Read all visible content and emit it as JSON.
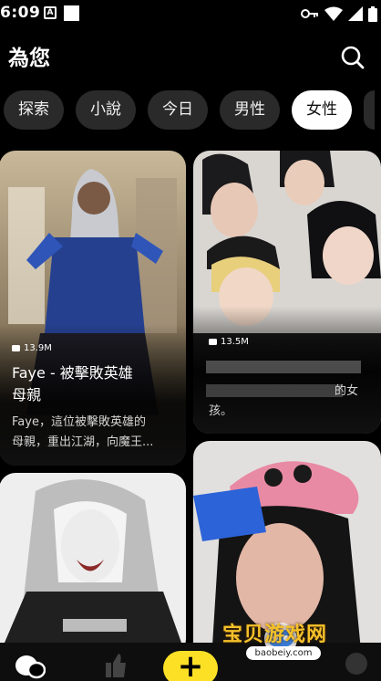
{
  "status_bar": {
    "time": "6:09",
    "notification_letter": "A"
  },
  "header": {
    "title": "為您"
  },
  "chips": [
    {
      "label": "探索",
      "active": false
    },
    {
      "label": "小說",
      "active": false
    },
    {
      "label": "今日",
      "active": false
    },
    {
      "label": "男性",
      "active": false
    },
    {
      "label": "女性",
      "active": true
    }
  ],
  "cards": [
    {
      "views": "13.9M",
      "title_line1": "Faye - 被擊敗英雄",
      "title_line2": "母親",
      "desc_line1": "Faye，這位被擊敗英雄的",
      "desc_line2": "母親，重出江湖，向魔王..."
    },
    {
      "views": "13.5M",
      "title_line1": "",
      "desc_line1": "的女",
      "desc_line2": "孩。"
    }
  ],
  "watermark": {
    "text": "宝贝游戏网",
    "url": "baobeiy.com"
  },
  "nav": {
    "create_label": "+"
  },
  "colors": {
    "accent": "#fbe026",
    "chip_bg": "#2a2a2a",
    "card_bg": "#1a1a1a"
  }
}
